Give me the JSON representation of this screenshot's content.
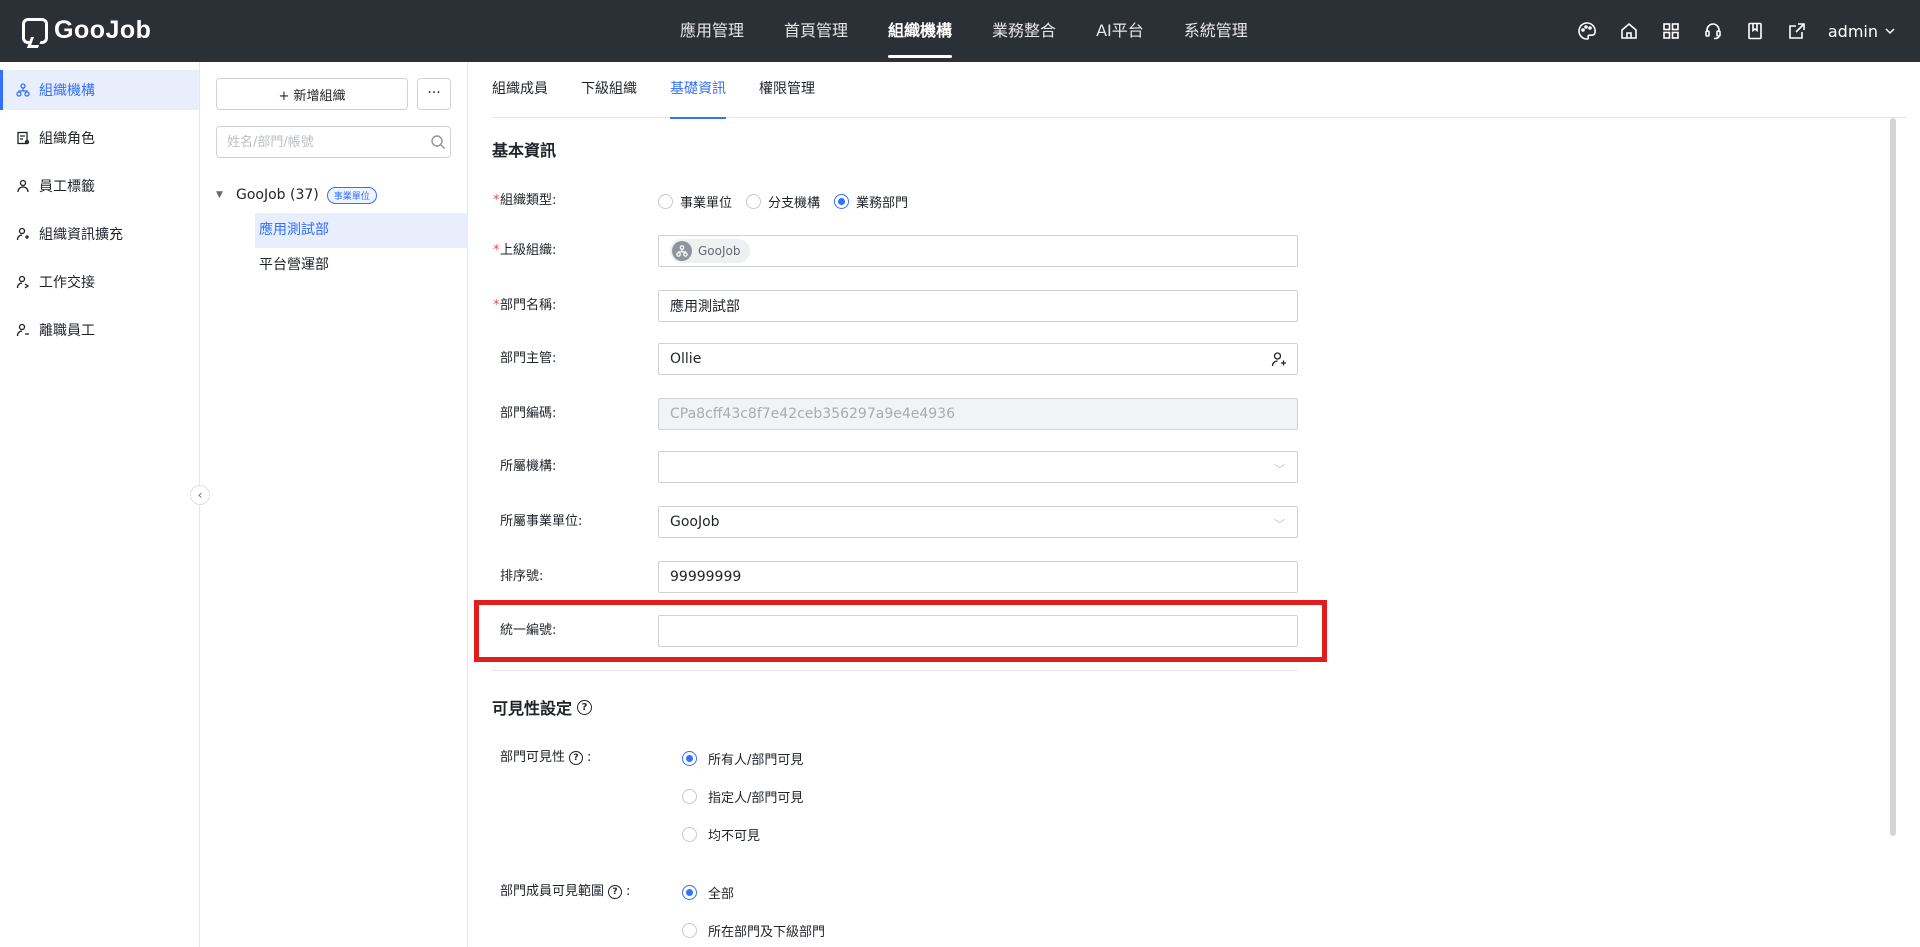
{
  "topbar": {
    "logo": "GooJob",
    "nav": [
      "應用管理",
      "首頁管理",
      "組織機構",
      "業務整合",
      "AI平台",
      "系統管理"
    ],
    "active_nav": "組織機構",
    "icons": [
      "palette-icon",
      "home-icon",
      "apps-grid-icon",
      "support-icon",
      "book-icon",
      "export-icon"
    ],
    "user": "admin"
  },
  "sidebar": {
    "items": [
      {
        "label": "組織機構",
        "icon": "org-icon",
        "active": true
      },
      {
        "label": "組織角色",
        "icon": "role-icon",
        "active": false
      },
      {
        "label": "員工標籤",
        "icon": "tag-icon",
        "active": false
      },
      {
        "label": "組織資訊擴充",
        "icon": "extend-icon",
        "active": false
      },
      {
        "label": "工作交接",
        "icon": "handover-icon",
        "active": false
      },
      {
        "label": "離職員工",
        "icon": "resigned-icon",
        "active": false
      }
    ]
  },
  "tree": {
    "add_button": "+ 新增組織",
    "more_button": "···",
    "search_placeholder": "姓名/部門/帳號",
    "root": {
      "label": "GooJob (37)",
      "badge": "事業單位"
    },
    "children": [
      {
        "label": "應用測試部",
        "active": true
      },
      {
        "label": "平台營運部",
        "active": false
      }
    ]
  },
  "tabs": [
    "組織成員",
    "下級組織",
    "基礎資訊",
    "權限管理"
  ],
  "active_tab": "基礎資訊",
  "basic_info": {
    "title": "基本資訊",
    "org_type": {
      "label": "組織類型:",
      "options": [
        "事業單位",
        "分支機構",
        "業務部門"
      ],
      "selected": "業務部門"
    },
    "parent_org": {
      "label": "上級組織:",
      "value": "GooJob"
    },
    "dept_name": {
      "label": "部門名稱:",
      "value": "應用測試部"
    },
    "dept_manager": {
      "label": "部門主管:",
      "value": "Ollie"
    },
    "dept_code": {
      "label": "部門編碼:",
      "value": "CPa8cff43c8f7e42ceb356297a9e4e4936"
    },
    "belong_org": {
      "label": "所屬機構:",
      "value": ""
    },
    "belong_unit": {
      "label": "所屬事業單位:",
      "value": "GooJob"
    },
    "sort_no": {
      "label": "排序號:",
      "value": "99999999"
    },
    "unified_no": {
      "label": "統一編號:",
      "value": ""
    }
  },
  "visibility": {
    "title": "可見性設定",
    "dept_visibility": {
      "label": "部門可見性",
      "options": [
        "所有人/部門可見",
        "指定人/部門可見",
        "均不可見"
      ],
      "selected": "所有人/部門可見"
    },
    "member_scope": {
      "label": "部門成員可見範圍",
      "options": [
        "全部",
        "所在部門及下級部門"
      ],
      "selected": "全部"
    }
  },
  "colors": {
    "accent": "#3370ff",
    "topbar": "#2b2f36",
    "highlight": "#e01e1e",
    "required": "#f54a45"
  }
}
